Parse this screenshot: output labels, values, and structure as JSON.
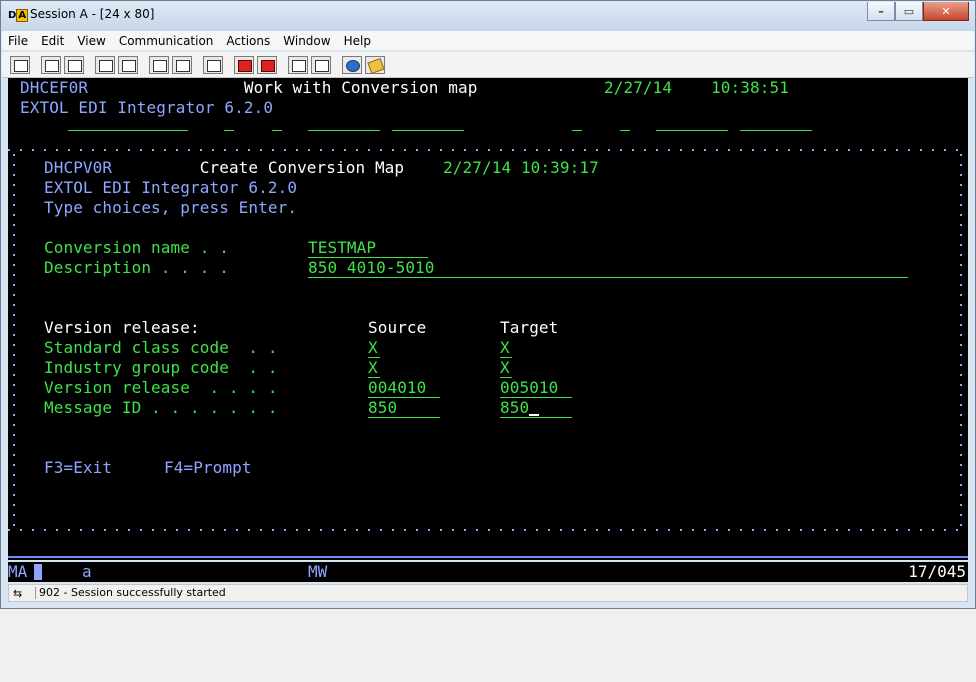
{
  "window": {
    "title": "Session A - [24 x 80]",
    "icon_letter": "A",
    "icon_prefix": "D"
  },
  "menu": [
    "File",
    "Edit",
    "View",
    "Communication",
    "Actions",
    "Window",
    "Help"
  ],
  "toolbar_icons": [
    "print-screen-icon",
    "copy-icon",
    "paste-icon",
    "send-icon",
    "receive-icon",
    "display-icon",
    "keypad-icon",
    "record-macro-icon",
    "stop-macro-icon",
    "play-macro-icon",
    "script-icon",
    "globe-icon",
    "notes-icon"
  ],
  "screen": {
    "header1": {
      "program": "DHCEF0R",
      "title": "Work with Conversion map",
      "date": "2/27/14",
      "time": "10:38:51"
    },
    "header2": "EXTOL EDI Integrator 6.2.0",
    "popup": {
      "program": "DHCPV0R",
      "title": "Create Conversion Map",
      "date": "2/27/14",
      "time": "10:39:17",
      "product": "EXTOL EDI Integrator 6.2.0",
      "instructions": "Type choices, press Enter.",
      "conversion_name_label": "Conversion name . .",
      "conversion_name_value": "TESTMAP",
      "description_label": "Description . . . .",
      "description_value": "850 4010-5010",
      "version_release_header": "Version release:",
      "source_header": "Source",
      "target_header": "Target",
      "rows": [
        {
          "label": "Standard class code  . .",
          "source": "X",
          "target": "X"
        },
        {
          "label": "Industry group code  . .",
          "source": "X",
          "target": "X"
        },
        {
          "label": "Version release  . . . .",
          "source": "004010",
          "target": "005010"
        },
        {
          "label": "Message ID . . . . . . .",
          "source": "850",
          "target": "850"
        }
      ],
      "f3": "F3=Exit",
      "f4": "F4=Prompt"
    }
  },
  "oia": {
    "ma": "MA",
    "session": "a",
    "mw": "MW",
    "cursor_pos": "17/045"
  },
  "status": {
    "text": "902 - Session successfully started"
  }
}
